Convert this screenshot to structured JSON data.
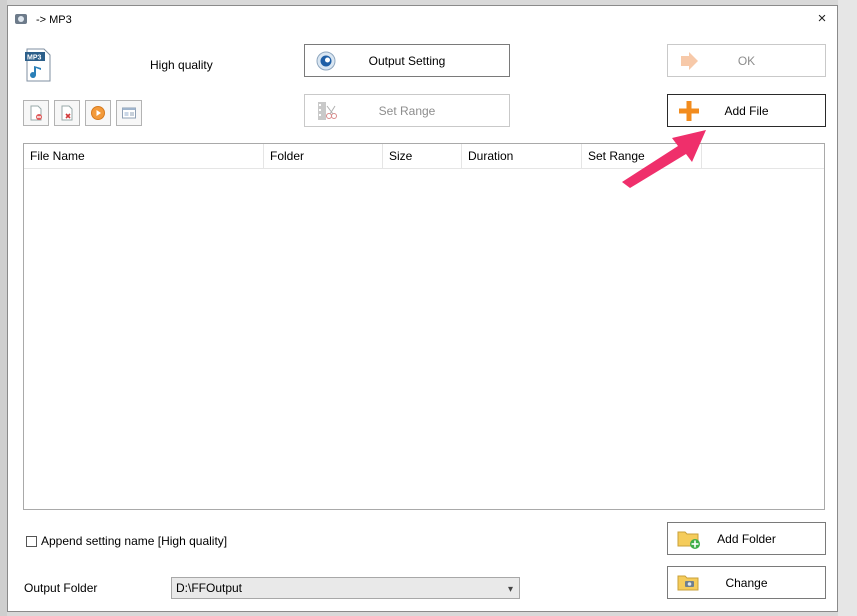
{
  "window": {
    "title": "-> MP3",
    "close_glyph": "×"
  },
  "quality_label": "High quality",
  "buttons": {
    "output_setting": "Output Setting",
    "ok": "OK",
    "set_range": "Set Range",
    "add_file": "Add File",
    "add_folder": "Add Folder",
    "change": "Change"
  },
  "toolbar_icons": [
    "remove-file-icon",
    "delete-icon",
    "play-icon",
    "media-info-icon"
  ],
  "table": {
    "columns": [
      "File Name",
      "Folder",
      "Size",
      "Duration",
      "Set Range"
    ],
    "rows": []
  },
  "append_setting": {
    "label": "Append setting name [High quality]",
    "checked": false
  },
  "output_folder": {
    "label": "Output Folder",
    "value": "D:\\FFOutput"
  },
  "colors": {
    "accent_arrow": "#ef2f6b",
    "plus_orange": "#f28c1e"
  }
}
